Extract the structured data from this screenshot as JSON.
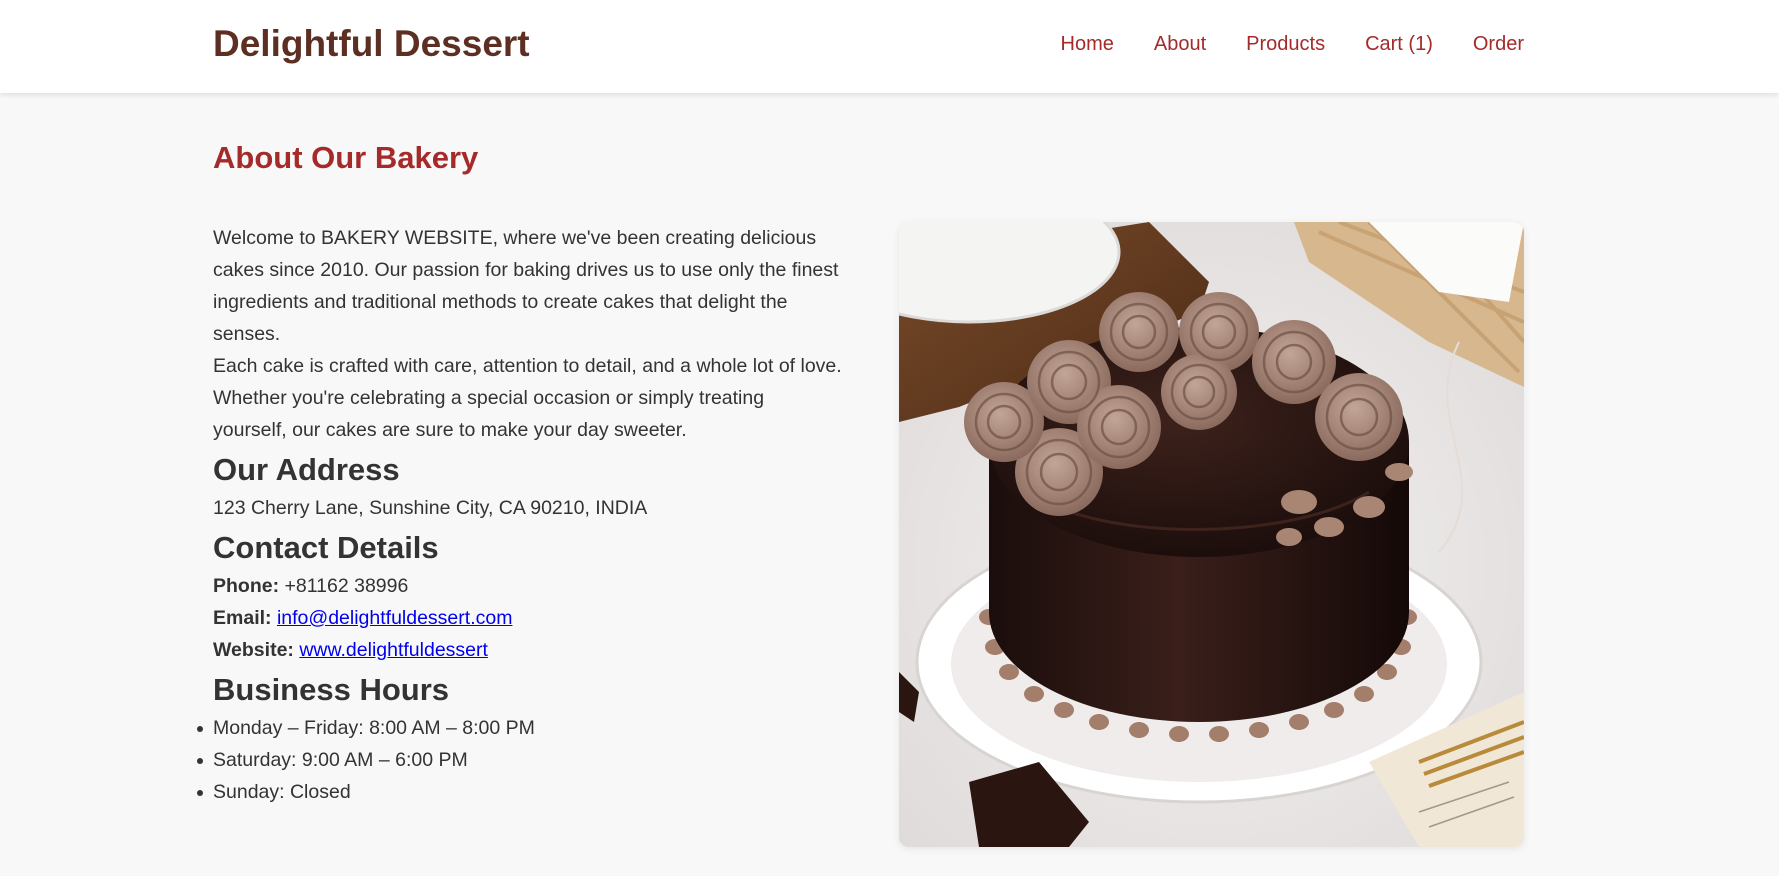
{
  "header": {
    "brand": "Delightful Dessert",
    "nav": [
      "Home",
      "About",
      "Products",
      "Cart (1)",
      "Order"
    ]
  },
  "about": {
    "title": "About Our Bakery",
    "paragraphs": [
      "Welcome to BAKERY WEBSITE, where we've been creating delicious cakes since 2010. Our passion for baking drives us to use only the finest ingredients and traditional methods to create cakes that delight the senses.",
      "Each cake is crafted with care, attention to detail, and a whole lot of love. Whether you're celebrating a special occasion or simply treating yourself, our cakes are sure to make your day sweeter."
    ]
  },
  "address": {
    "heading": "Our Address",
    "text": "123 Cherry Lane, Sunshine City, CA 90210, INDIA"
  },
  "contact": {
    "heading": "Contact Details",
    "phone_label": "Phone:",
    "phone": "+81162 38996",
    "email_label": "Email:",
    "email": "info@delightfuldessert.com",
    "website_label": "Website:",
    "website": "www.delightfuldessert"
  },
  "hours": {
    "heading": "Business Hours",
    "items": [
      "Monday – Friday: 8:00 AM – 8:00 PM",
      "Saturday: 9:00 AM – 6:00 PM",
      "Sunday: Closed"
    ]
  },
  "image": {
    "subject": "chocolate cake with buttercream roses"
  },
  "colors": {
    "brand": "#5d2e22",
    "accent": "#a52a2a",
    "link": "#0000ee",
    "text": "#333333",
    "background": "#f8f8f8"
  }
}
